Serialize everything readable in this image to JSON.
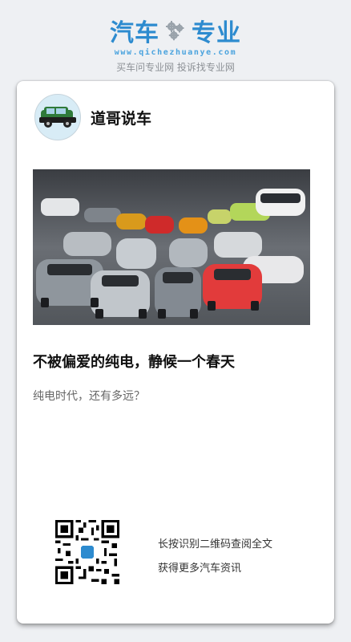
{
  "brand": {
    "logo_left": "汽车",
    "logo_icon": "gear-icon",
    "logo_right": "专业",
    "url": "www.qichezhuanye.com",
    "tagline": "买车问专业网 投诉找专业网",
    "color": "#2d8bcf"
  },
  "card": {
    "author": {
      "avatar_icon": "green-suv-avatar",
      "name": "道哥说车"
    },
    "hero_image_icon": "lineup-of-electric-concept-cars",
    "headline": "不被偏爱的纯电，静候一个春天",
    "subtitle": "纯电时代，还有多远？",
    "qr_icon": "qr-code-icon",
    "qr_lines": [
      "长按识别二维码查阅全文",
      "获得更多汽车资讯"
    ]
  }
}
